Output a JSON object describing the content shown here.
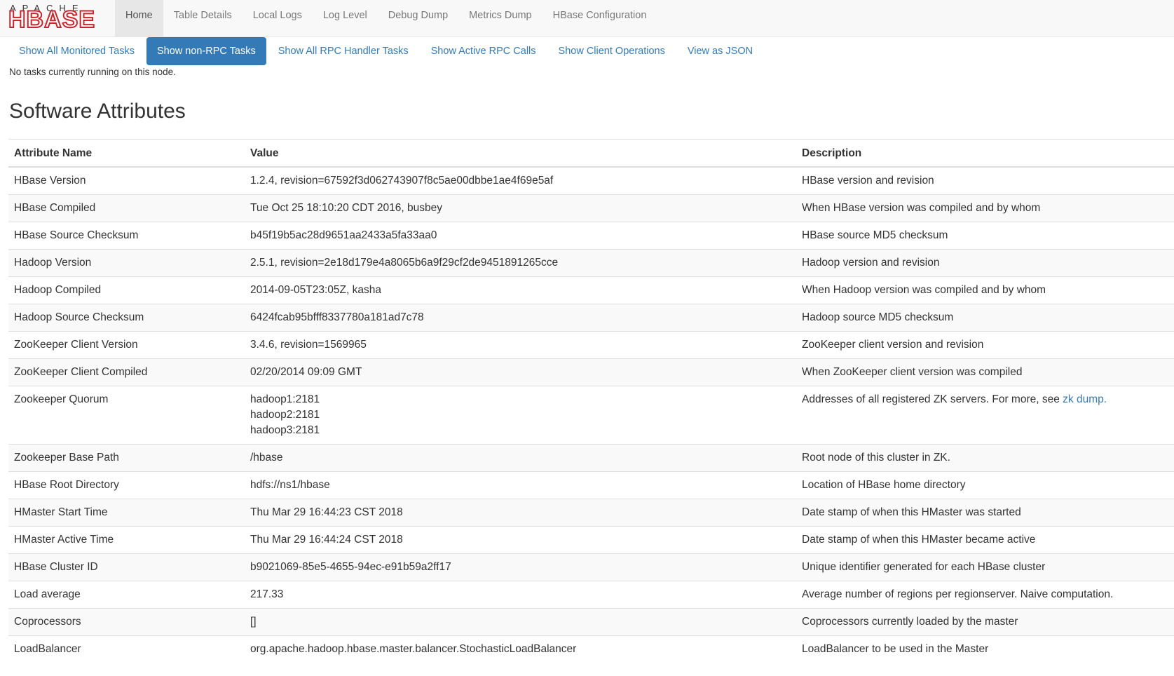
{
  "logo": {
    "top": "APACHE",
    "main": "HBASE"
  },
  "nav": [
    {
      "label": "Home",
      "active": true
    },
    {
      "label": "Table Details",
      "active": false
    },
    {
      "label": "Local Logs",
      "active": false
    },
    {
      "label": "Log Level",
      "active": false
    },
    {
      "label": "Debug Dump",
      "active": false
    },
    {
      "label": "Metrics Dump",
      "active": false
    },
    {
      "label": "HBase Configuration",
      "active": false
    }
  ],
  "tasks": {
    "pills": [
      {
        "label": "Show All Monitored Tasks",
        "active": false
      },
      {
        "label": "Show non-RPC Tasks",
        "active": true
      },
      {
        "label": "Show All RPC Handler Tasks",
        "active": false
      },
      {
        "label": "Show Active RPC Calls",
        "active": false
      },
      {
        "label": "Show Client Operations",
        "active": false
      },
      {
        "label": "View as JSON",
        "active": false
      }
    ],
    "message": "No tasks currently running on this node."
  },
  "software": {
    "title": "Software Attributes",
    "headers": [
      "Attribute Name",
      "Value",
      "Description"
    ],
    "rows": [
      {
        "name": "HBase Version",
        "value": [
          "1.2.4, revision=67592f3d062743907f8c5ae00dbbe1ae4f69e5af"
        ],
        "desc": "HBase version and revision"
      },
      {
        "name": "HBase Compiled",
        "value": [
          "Tue Oct 25 18:10:20 CDT 2016, busbey"
        ],
        "desc": "When HBase version was compiled and by whom"
      },
      {
        "name": "HBase Source Checksum",
        "value": [
          "b45f19b5ac28d9651aa2433a5fa33aa0"
        ],
        "desc": "HBase source MD5 checksum"
      },
      {
        "name": "Hadoop Version",
        "value": [
          "2.5.1, revision=2e18d179e4a8065b6a9f29cf2de9451891265cce"
        ],
        "desc": "Hadoop version and revision"
      },
      {
        "name": "Hadoop Compiled",
        "value": [
          "2014-09-05T23:05Z, kasha"
        ],
        "desc": "When Hadoop version was compiled and by whom"
      },
      {
        "name": "Hadoop Source Checksum",
        "value": [
          "6424fcab95bfff8337780a181ad7c78"
        ],
        "desc": "Hadoop source MD5 checksum"
      },
      {
        "name": "ZooKeeper Client Version",
        "value": [
          "3.4.6, revision=1569965"
        ],
        "desc": "ZooKeeper client version and revision"
      },
      {
        "name": "ZooKeeper Client Compiled",
        "value": [
          "02/20/2014 09:09 GMT"
        ],
        "desc": "When ZooKeeper client version was compiled"
      },
      {
        "name": "Zookeeper Quorum",
        "value": [
          "hadoop1:2181",
          "hadoop2:2181",
          "hadoop3:2181"
        ],
        "desc": "Addresses of all registered ZK servers. For more, see ",
        "desc_link": "zk dump."
      },
      {
        "name": "Zookeeper Base Path",
        "value": [
          "/hbase"
        ],
        "desc": "Root node of this cluster in ZK."
      },
      {
        "name": "HBase Root Directory",
        "value": [
          "hdfs://ns1/hbase"
        ],
        "desc": "Location of HBase home directory"
      },
      {
        "name": "HMaster Start Time",
        "value": [
          "Thu Mar 29 16:44:23 CST 2018"
        ],
        "desc": "Date stamp of when this HMaster was started"
      },
      {
        "name": "HMaster Active Time",
        "value": [
          "Thu Mar 29 16:44:24 CST 2018"
        ],
        "desc": "Date stamp of when this HMaster became active"
      },
      {
        "name": "HBase Cluster ID",
        "value": [
          "b9021069-85e5-4655-94ec-e91b59a2ff17"
        ],
        "desc": "Unique identifier generated for each HBase cluster"
      },
      {
        "name": "Load average",
        "value": [
          "217.33"
        ],
        "desc": "Average number of regions per regionserver. Naive computation."
      },
      {
        "name": "Coprocessors",
        "value": [
          "[]"
        ],
        "desc": "Coprocessors currently loaded by the master"
      },
      {
        "name": "LoadBalancer",
        "value": [
          "org.apache.hadoop.hbase.master.balancer.StochasticLoadBalancer"
        ],
        "desc": "LoadBalancer to be used in the Master"
      }
    ]
  },
  "colors": {
    "link": "#337ab7",
    "brand": "#c9252b",
    "active_pill": "#337ab7"
  }
}
